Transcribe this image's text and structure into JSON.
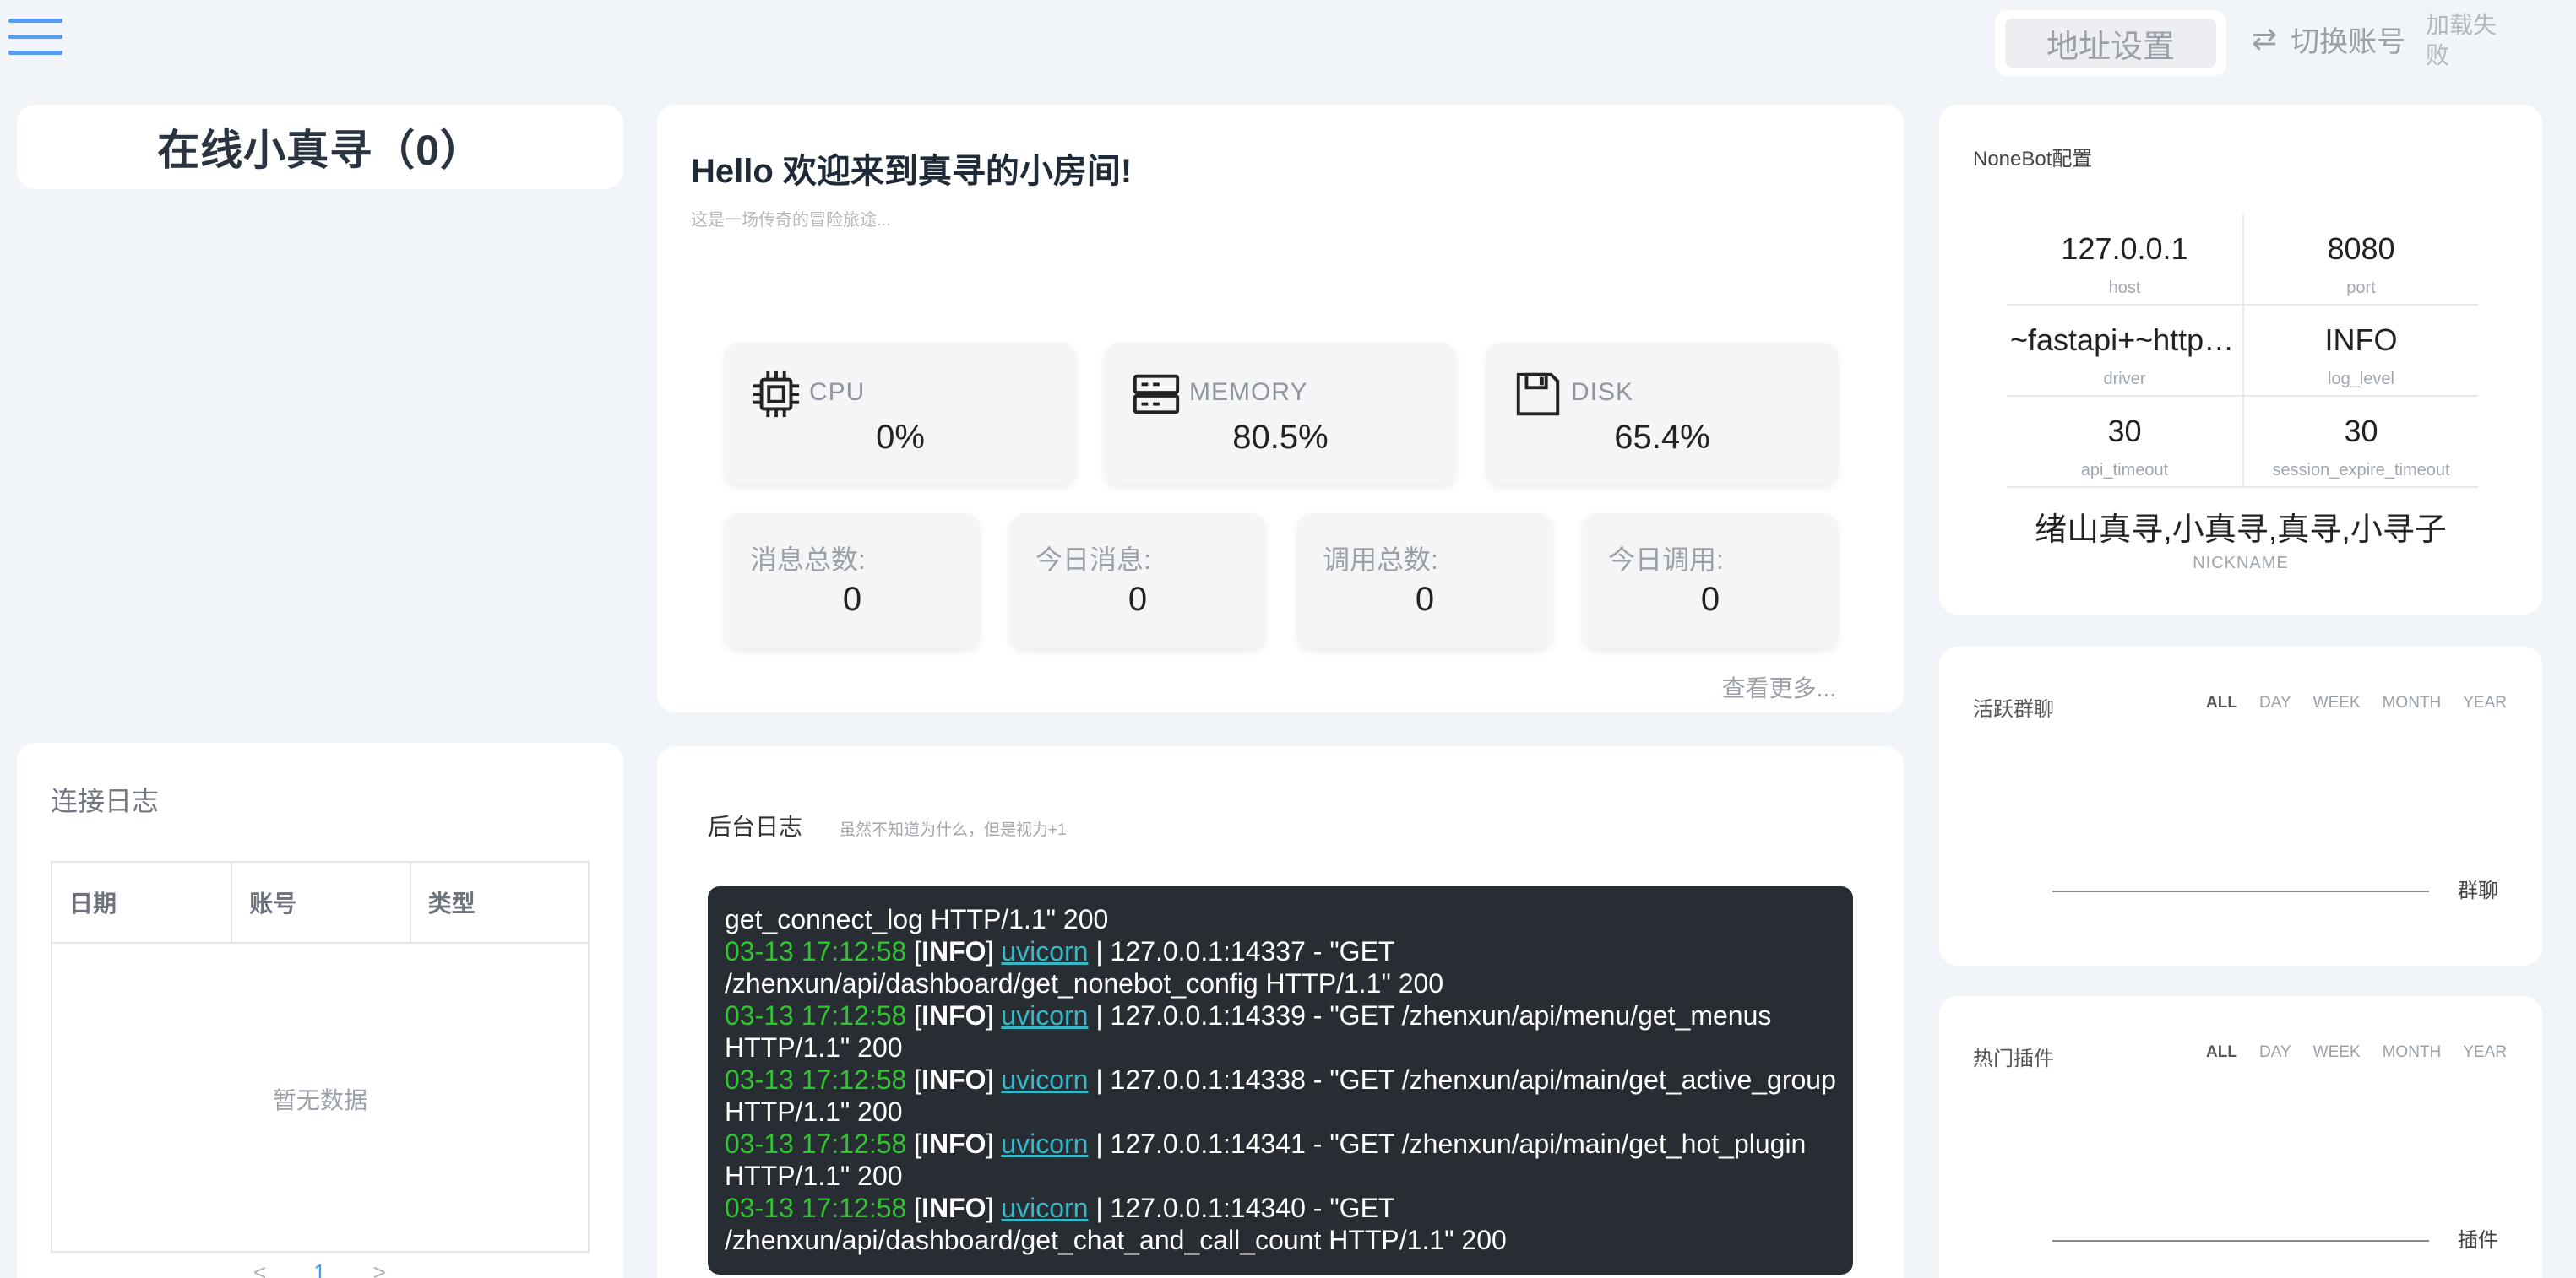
{
  "header": {
    "addr_settings": "地址设置",
    "switch_account": "切换账号",
    "load_fail": "加载失败"
  },
  "online": {
    "title": "在线小真寻（0）"
  },
  "welcome": {
    "title": "Hello 欢迎来到真寻的小房间!",
    "subtitle": "这是一场传奇的冒险旅途..."
  },
  "system": [
    {
      "label": "CPU",
      "value": "0%",
      "icon": "cpu-icon"
    },
    {
      "label": "MEMORY",
      "value": "80.5%",
      "icon": "memory-icon"
    },
    {
      "label": "DISK",
      "value": "65.4%",
      "icon": "disk-icon"
    }
  ],
  "counts": [
    {
      "label": "消息总数:",
      "value": "0"
    },
    {
      "label": "今日消息:",
      "value": "0"
    },
    {
      "label": "调用总数:",
      "value": "0"
    },
    {
      "label": "今日调用:",
      "value": "0"
    }
  ],
  "see_more": "查看更多...",
  "nonebot": {
    "title": "NoneBot配置",
    "rows": [
      [
        {
          "v": "127.0.0.1",
          "k": "host"
        },
        {
          "v": "8080",
          "k": "port"
        }
      ],
      [
        {
          "v": "~fastapi+~httpx+~websockets",
          "k": "driver"
        },
        {
          "v": "INFO",
          "k": "log_level"
        }
      ],
      [
        {
          "v": "30",
          "k": "api_timeout"
        },
        {
          "v": "30",
          "k": "session_expire_timeout"
        }
      ]
    ],
    "nickname": "绪山真寻,小真寻,真寻,小寻子",
    "nickname_key": "NICKNAME"
  },
  "period_tabs": [
    "ALL",
    "DAY",
    "WEEK",
    "MONTH",
    "YEAR"
  ],
  "active_group": {
    "title": "活跃群聊",
    "axis_label": "群聊"
  },
  "hot_plugin": {
    "title": "热门插件",
    "axis_label": "插件"
  },
  "connect_log": {
    "title": "连接日志",
    "columns": [
      "日期",
      "账号",
      "类型"
    ],
    "empty": "暂无数据",
    "pager": {
      "prev": "<",
      "page": "1",
      "next": ">"
    }
  },
  "backend_log": {
    "title": "后台日志",
    "subtitle": "虽然不知道为什么，但是视力+1",
    "first_line": "get_connect_log HTTP/1.1\" 200",
    "entries": [
      {
        "ts": "03-13 17:12:58",
        "level": "INFO",
        "module": "uvicorn",
        "msg": "| 127.0.0.1:14337 - \"GET /zhenxun/api/dashboard/get_nonebot_config HTTP/1.1\" 200"
      },
      {
        "ts": "03-13 17:12:58",
        "level": "INFO",
        "module": "uvicorn",
        "msg": "| 127.0.0.1:14339 - \"GET /zhenxun/api/menu/get_menus HTTP/1.1\" 200"
      },
      {
        "ts": "03-13 17:12:58",
        "level": "INFO",
        "module": "uvicorn",
        "msg": "| 127.0.0.1:14338 - \"GET /zhenxun/api/main/get_active_group HTTP/1.1\" 200"
      },
      {
        "ts": "03-13 17:12:58",
        "level": "INFO",
        "module": "uvicorn",
        "msg": "| 127.0.0.1:14341 - \"GET /zhenxun/api/main/get_hot_plugin HTTP/1.1\" 200"
      },
      {
        "ts": "03-13 17:12:58",
        "level": "INFO",
        "module": "uvicorn",
        "msg": "| 127.0.0.1:14340 - \"GET /zhenxun/api/dashboard/get_chat_and_call_count HTTP/1.1\" 200"
      }
    ]
  },
  "colors": {
    "accent": "#409eff",
    "log_bg": "#282c33",
    "log_ts": "#2fc52f",
    "log_module": "#38b7c6",
    "menu": "#5a9cf0"
  }
}
